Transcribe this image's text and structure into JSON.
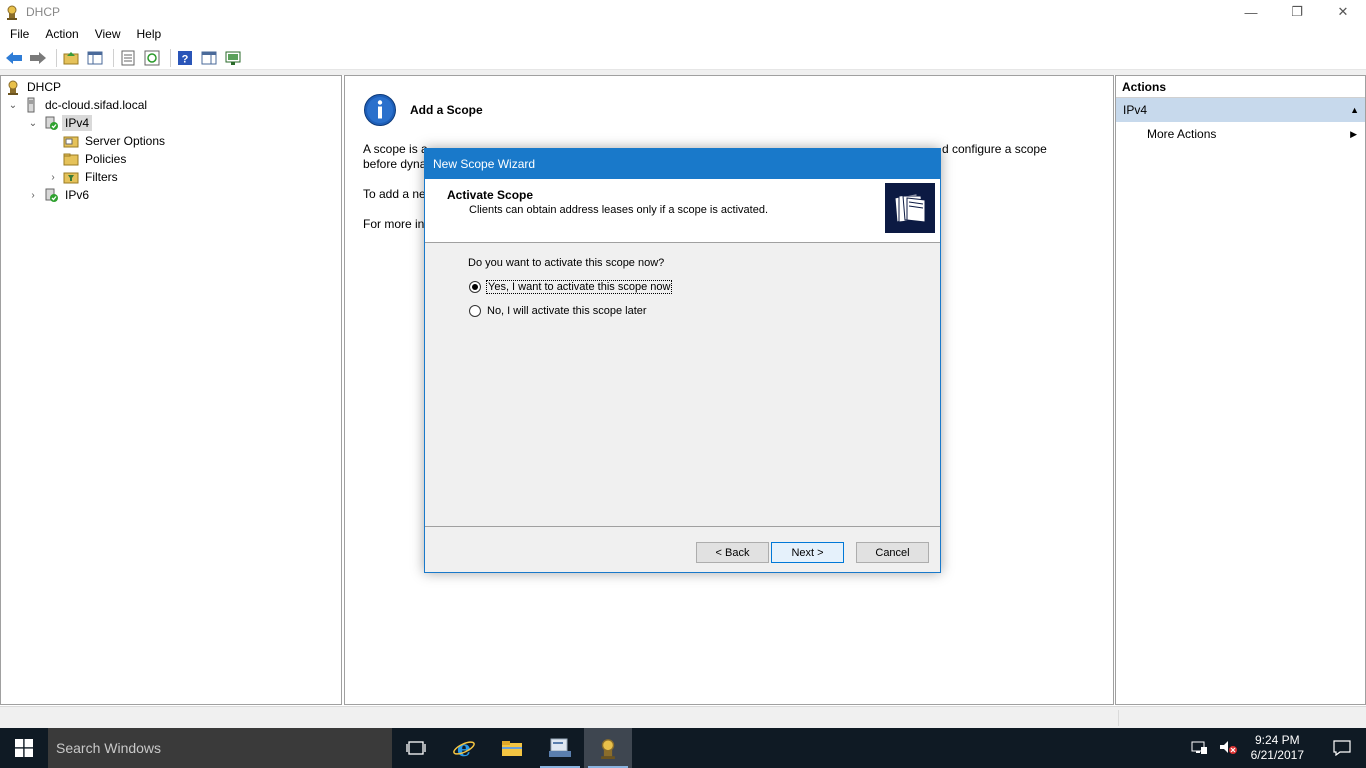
{
  "window": {
    "title": "DHCP",
    "controls": [
      "minimize",
      "restore",
      "close"
    ]
  },
  "menu": [
    "File",
    "Action",
    "View",
    "Help"
  ],
  "tree": {
    "root": "DHCP",
    "server": "dc-cloud.sifad.local",
    "ipv4": "IPv4",
    "server_options": "Server Options",
    "policies": "Policies",
    "filters": "Filters",
    "ipv6": "IPv6"
  },
  "center": {
    "title": "Add a Scope",
    "line1_left": "A scope is a",
    "line1_right": "d configure a scope",
    "line2": "before dyna",
    "line3": "To add a ne",
    "line4": "For more in"
  },
  "actions": {
    "header": "Actions",
    "section": "IPv4",
    "more": "More Actions"
  },
  "dialog": {
    "title": "New Scope Wizard",
    "heading": "Activate Scope",
    "subheading": "Clients can obtain address leases only if a scope is activated.",
    "question": "Do you want to activate this scope now?",
    "option_yes": "Yes, I want to activate this scope now",
    "option_no": "No, I will activate this scope later",
    "selected": "yes",
    "back": "< Back",
    "next": "Next >",
    "cancel": "Cancel"
  },
  "taskbar": {
    "search_placeholder": "Search Windows",
    "time": "9:24 PM",
    "date": "6/21/2017"
  }
}
